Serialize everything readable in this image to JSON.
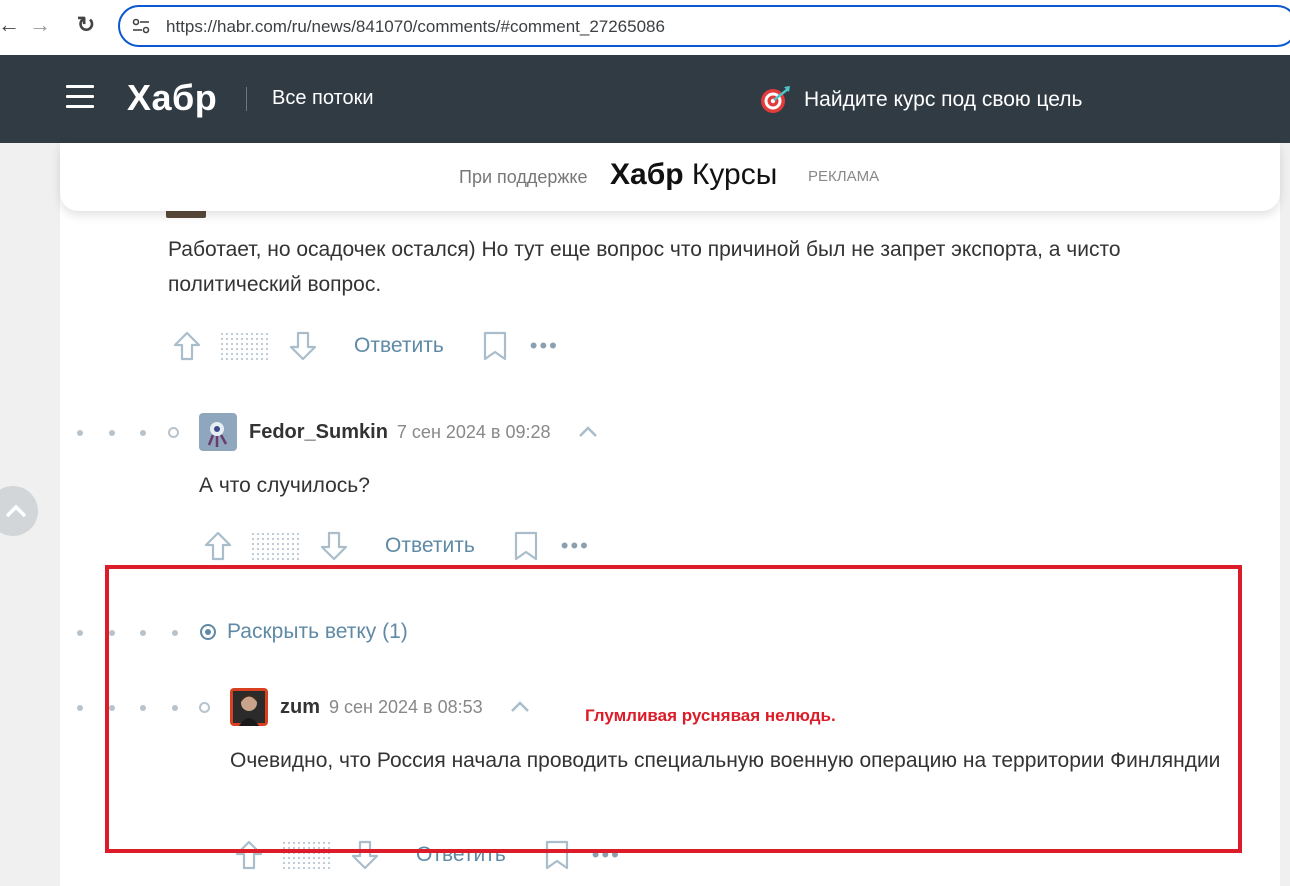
{
  "browser": {
    "url": "https://habr.com/ru/news/841070/comments/#comment_27265086",
    "back_glyph": "←",
    "forward_glyph": "→",
    "reload_glyph": "↻"
  },
  "header": {
    "logo": "Хабр",
    "all_streams": "Все потоки",
    "promo": "Найдите курс под свою цель"
  },
  "sponsor": {
    "label": "При поддержке",
    "brand_bold": "Хабр",
    "brand_rest": " Курсы",
    "ad": "РЕКЛАМА"
  },
  "comments": [
    {
      "text": "Работает, но осадочек остался) Но тут еще вопрос что причиной был не запрет экспорта, а чисто политический вопрос.",
      "reply": "Ответить"
    },
    {
      "username": "Fedor_Sumkin",
      "date": "7 сен 2024 в 09:28",
      "text": "А что случилось?",
      "reply": "Ответить"
    },
    {
      "username": "zum",
      "date": "9 сен 2024 в 08:53",
      "text": "Очевидно, что Россия начала проводить специальную военную операцию на территории Финляндии",
      "reply": "Ответить"
    }
  ],
  "expand_thread": "Раскрыть ветку (1)",
  "annotation": "Глумливая руснявая нелюдь.",
  "colors": {
    "header_bg": "#303b44",
    "link": "#5e8aa6",
    "highlight": "#dc1c28"
  }
}
